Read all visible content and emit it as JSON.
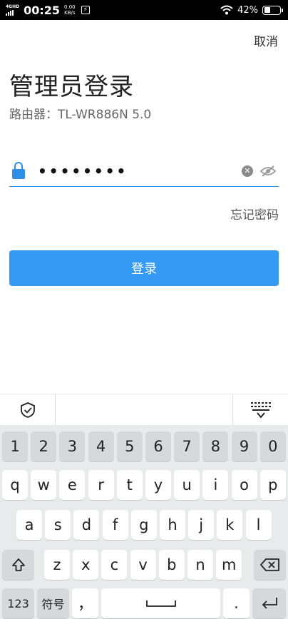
{
  "status_bar": {
    "network": "4GHD",
    "time": "00:25",
    "speed_value": "0.00",
    "speed_unit": "KB/s",
    "battery": "42%"
  },
  "header": {
    "cancel_label": "取消"
  },
  "login": {
    "title": "管理员登录",
    "subtitle": "路由器：TL-WR886N 5.0",
    "password_value": "••••••••",
    "forgot_label": "忘记密码",
    "login_button": "登录"
  },
  "keyboard": {
    "number_row": [
      "1",
      "2",
      "3",
      "4",
      "5",
      "6",
      "7",
      "8",
      "9",
      "0"
    ],
    "row1": [
      "q",
      "w",
      "e",
      "r",
      "t",
      "y",
      "u",
      "i",
      "o",
      "p"
    ],
    "row2": [
      "a",
      "s",
      "d",
      "f",
      "g",
      "h",
      "j",
      "k",
      "l"
    ],
    "row3": [
      "z",
      "x",
      "c",
      "v",
      "b",
      "n",
      "m"
    ],
    "mode_123": "123",
    "symbols": "符号",
    "comma": "，",
    "period": "."
  },
  "colors": {
    "accent": "#3399f3",
    "underline": "#2e8fe8"
  }
}
